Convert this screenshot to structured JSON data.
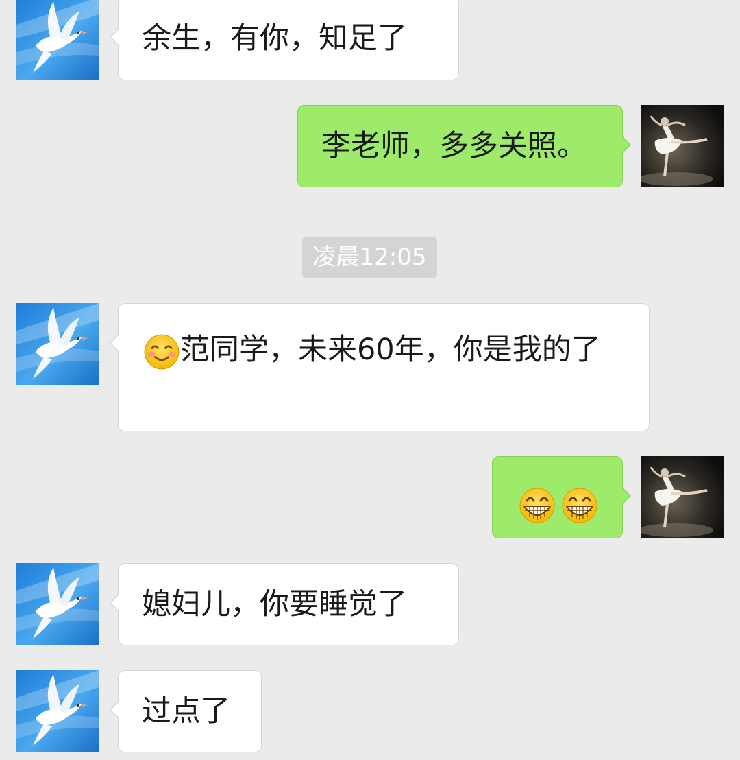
{
  "messages": [
    {
      "side": "in",
      "text": "余生，有你，知足了"
    },
    {
      "side": "out",
      "text": "李老师，多多关照。"
    },
    {
      "side": "in",
      "emoji": "smiling-blush-emoji",
      "text": "范同学，未来60年，你是我的了"
    },
    {
      "side": "out",
      "emoji": [
        "grinning-teeth-emoji",
        "grinning-teeth-emoji"
      ]
    },
    {
      "side": "in",
      "text": "媳妇儿，你要睡觉了"
    },
    {
      "side": "in",
      "text": "过点了"
    }
  ],
  "timestamp": "凌晨12:05",
  "avatars": {
    "incoming": "white-dove-avatar",
    "outgoing": "ballerina-avatar"
  },
  "colors": {
    "background": "#ebebeb",
    "incoming_bubble": "#ffffff",
    "outgoing_bubble": "#9eea6a",
    "timestamp_badge": "#d4d4d4"
  }
}
